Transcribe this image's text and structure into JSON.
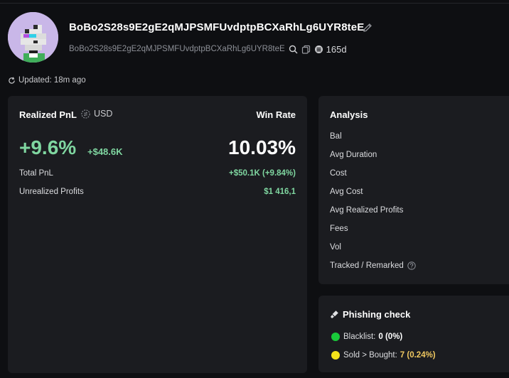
{
  "header": {
    "wallet_name": "BoBo2S28s9E2gE2qMJPSMFUvdptpBCXaRhLg6UYR8teE",
    "wallet_address": "BoBo2S28s9E2gE2qMJPSMFUvdptpBCXaRhLg6UYR8teE",
    "age": "165d",
    "updated": "Updated: 18m ago",
    "icons": [
      "avatar",
      "edit-icon",
      "search-icon",
      "copy-icon",
      "token-icon",
      "refresh-icon"
    ]
  },
  "pnl": {
    "title": "Realized PnL",
    "currency": "USD",
    "winrate_label": "Win Rate",
    "pct": "+9.6%",
    "usd": "+$48.6K",
    "winrate": "10.03%",
    "rows": [
      {
        "label": "Total PnL",
        "value": "+$50.1K (+9.84%)"
      },
      {
        "label": "Unrealized Profits",
        "value": "$1 416,1"
      }
    ],
    "positive_color": "#7fd6a0"
  },
  "analysis": {
    "title": "Analysis",
    "items": [
      "Bal",
      "Avg Duration",
      "Cost",
      "Avg Cost",
      "Avg Realized Profits",
      "Fees",
      "Vol",
      "Tracked / Remarked"
    ]
  },
  "phishing": {
    "title": "Phishing check",
    "rows": [
      {
        "label": "Blacklist:",
        "value": "0 (0%)",
        "dot_color": "#19c93a",
        "value_color": "#ffffff"
      },
      {
        "label": "Sold > Bought:",
        "value": "7 (0.24%)",
        "dot_color": "#f5e21a",
        "value_color": "#f0c860"
      }
    ]
  }
}
